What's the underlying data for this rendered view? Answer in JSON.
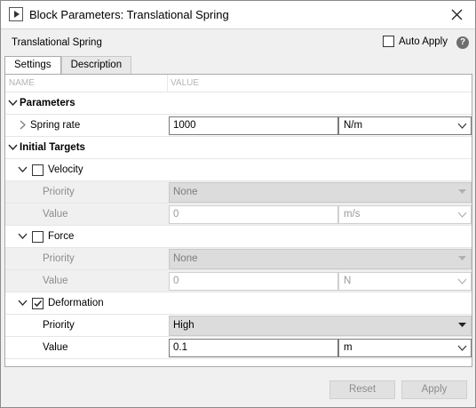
{
  "window": {
    "title": "Block Parameters: Translational Spring"
  },
  "header": {
    "block_name": "Translational Spring",
    "auto_apply_label": "Auto Apply",
    "auto_apply_checked": false,
    "help": "?"
  },
  "tabs": [
    {
      "label": "Settings",
      "active": true
    },
    {
      "label": "Description",
      "active": false
    }
  ],
  "columns": {
    "name": "NAME",
    "value": "VALUE"
  },
  "parameters": {
    "label": "Parameters",
    "spring_rate": {
      "label": "Spring rate",
      "value": "1000",
      "unit": "N/m"
    }
  },
  "initial_targets": {
    "label": "Initial Targets",
    "velocity": {
      "label": "Velocity",
      "checked": false,
      "priority_label": "Priority",
      "priority": "None",
      "value_label": "Value",
      "value": "0",
      "unit": "m/s"
    },
    "force": {
      "label": "Force",
      "checked": false,
      "priority_label": "Priority",
      "priority": "None",
      "value_label": "Value",
      "value": "0",
      "unit": "N"
    },
    "deformation": {
      "label": "Deformation",
      "checked": true,
      "priority_label": "Priority",
      "priority": "High",
      "value_label": "Value",
      "value": "0.1",
      "unit": "m"
    }
  },
  "footer": {
    "reset_label": "Reset",
    "apply_label": "Apply"
  }
}
